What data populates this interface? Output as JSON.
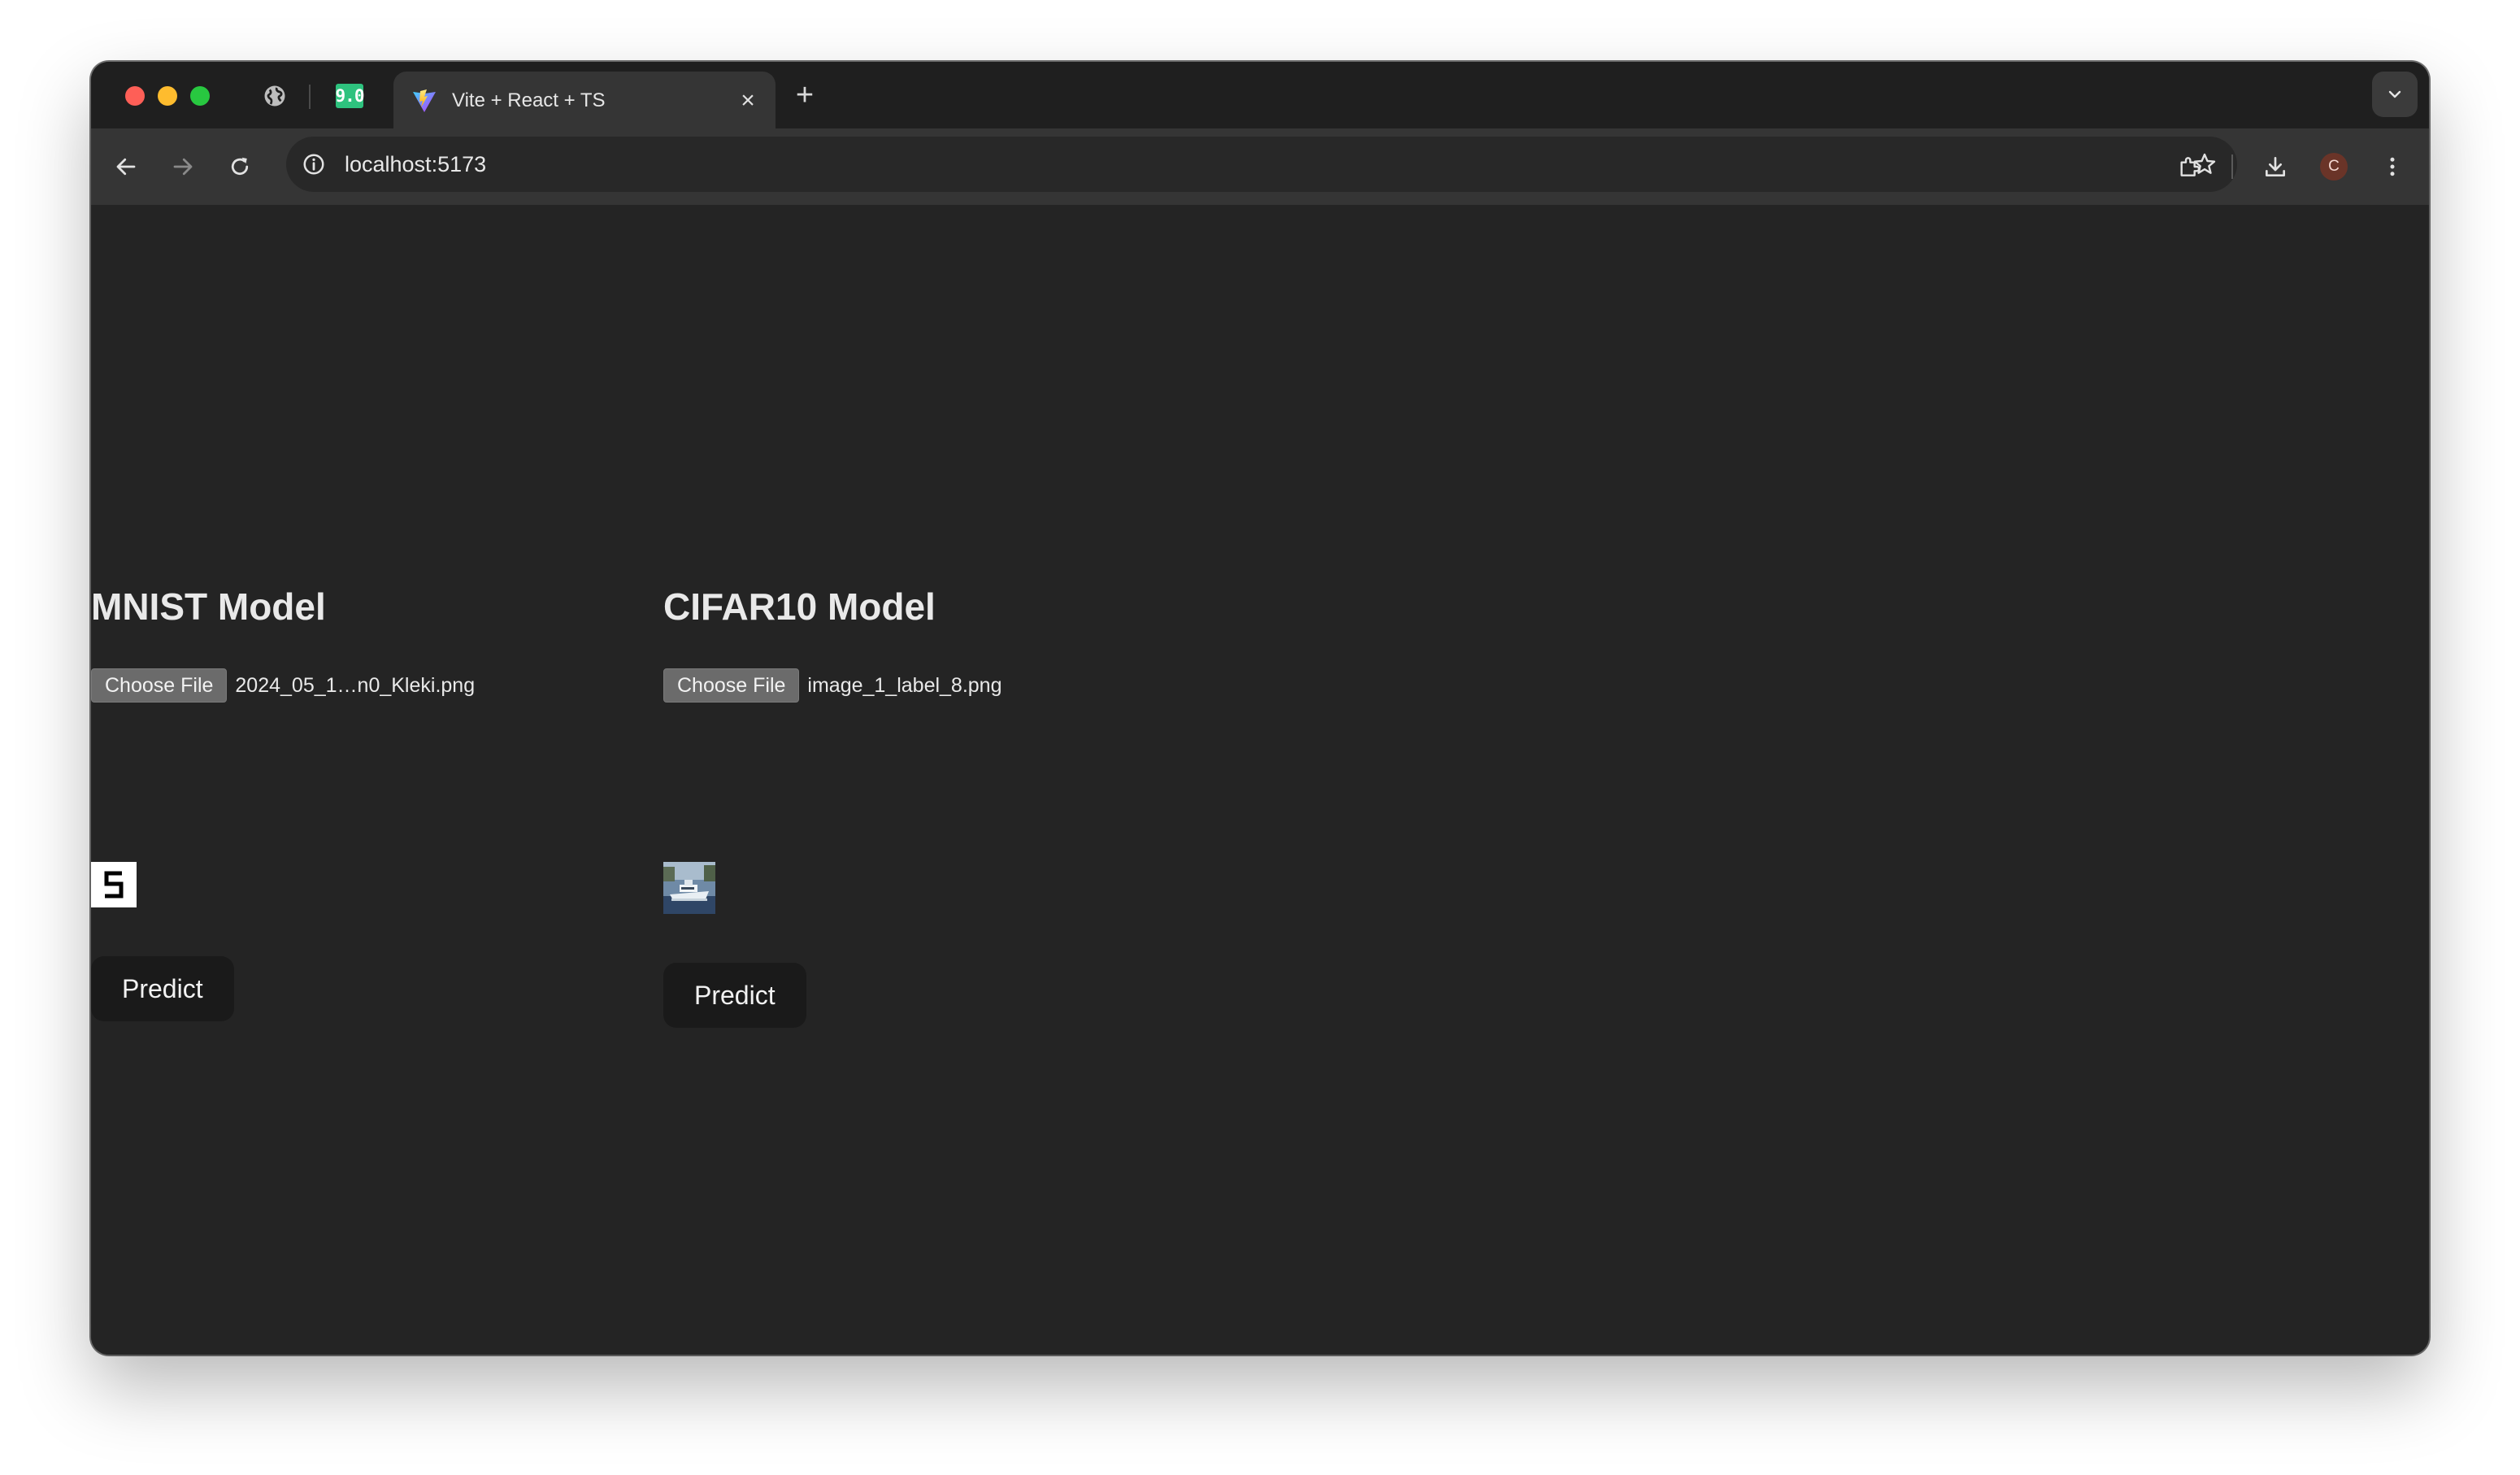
{
  "browser": {
    "pinned_tab_badge": "9.0",
    "active_tab": {
      "title": "Vite + React + TS"
    },
    "address_bar": {
      "url": "localhost:5173"
    },
    "profile_initial": "C"
  },
  "page": {
    "sections": [
      {
        "title": "MNIST Model",
        "choose_file_label": "Choose File",
        "file_name": "2024_05_1…n0_Kleki.png",
        "predict_label": "Predict"
      },
      {
        "title": "CIFAR10 Model",
        "choose_file_label": "Choose File",
        "file_name": "image_1_label_8.png",
        "predict_label": "Predict"
      }
    ]
  },
  "colors": {
    "page_background": "#242424",
    "predict_button": "#1a1a1a",
    "choose_file_button": "#6b6b6b"
  },
  "icons": [
    "globe-icon",
    "vite-logo-icon",
    "close-icon",
    "plus-icon",
    "chevron-down-icon",
    "back-arrow-icon",
    "forward-arrow-icon",
    "reload-icon",
    "info-icon",
    "star-icon",
    "extensions-icon",
    "download-icon",
    "kebab-menu-icon"
  ]
}
